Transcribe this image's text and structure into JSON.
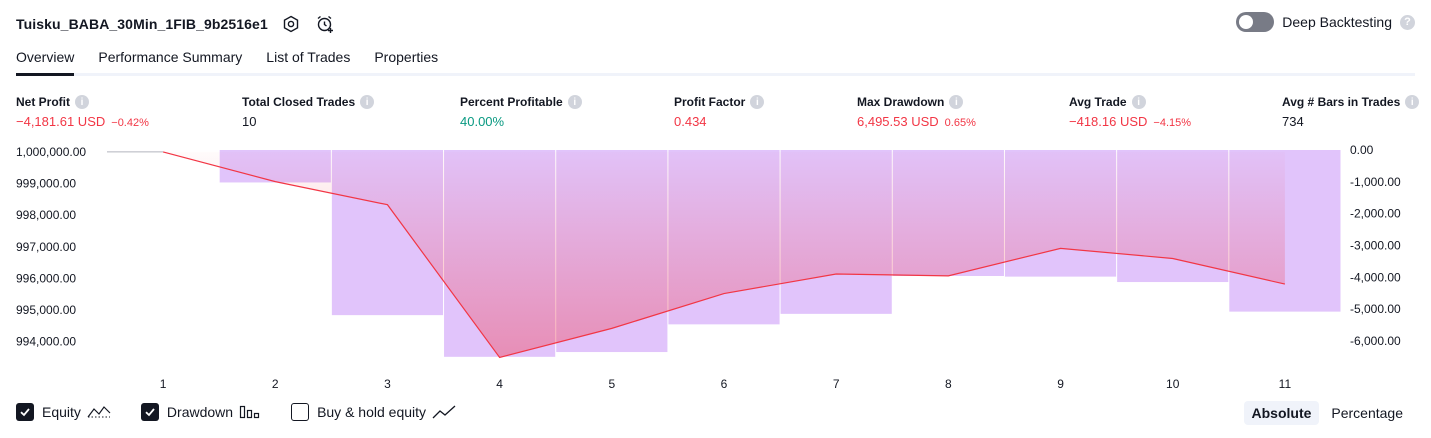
{
  "header": {
    "strategy_name": "Tuisku_BABA_30Min_1FIB_9b2516e1",
    "deep_backtesting_label": "Deep Backtesting",
    "help_glyph": "?"
  },
  "tabs": [
    {
      "label": "Overview",
      "active": true
    },
    {
      "label": "Performance Summary",
      "active": false
    },
    {
      "label": "List of Trades",
      "active": false
    },
    {
      "label": "Properties",
      "active": false
    }
  ],
  "metrics": [
    {
      "label": "Net Profit",
      "value": "−4,181.61 USD",
      "sub": "−0.42%",
      "tone": "neg"
    },
    {
      "label": "Total Closed Trades",
      "value": "10",
      "sub": "",
      "tone": "neutral"
    },
    {
      "label": "Percent Profitable",
      "value": "40.00%",
      "sub": "",
      "tone": "pos"
    },
    {
      "label": "Profit Factor",
      "value": "0.434",
      "sub": "",
      "tone": "neg"
    },
    {
      "label": "Max Drawdown",
      "value": "6,495.53 USD",
      "sub": "0.65%",
      "tone": "neg"
    },
    {
      "label": "Avg Trade",
      "value": "−418.16 USD",
      "sub": "−4.15%",
      "tone": "neg"
    },
    {
      "label": "Avg # Bars in Trades",
      "value": "734",
      "sub": "",
      "tone": "neutral"
    }
  ],
  "info_glyph": "i",
  "chart_data": {
    "type": "line",
    "x": [
      1,
      2,
      3,
      4,
      5,
      6,
      7,
      8,
      9,
      10,
      11
    ],
    "series": [
      {
        "name": "Equity",
        "kind": "line-area",
        "color": "#f23645",
        "values": [
          1000000,
          999060,
          998330,
          993500,
          994420,
          995520,
          996140,
          996080,
          996950,
          996630,
          995820
        ]
      },
      {
        "name": "Drawdown",
        "kind": "bar",
        "color": "#e1c4fb",
        "values": [
          0,
          -1020,
          -5190,
          -6500,
          -6350,
          -5480,
          -5150,
          -3960,
          -3980,
          -4150,
          -5080
        ]
      }
    ],
    "left_axis": {
      "ticks": [
        "1,000,000.00",
        "999,000.00",
        "998,000.00",
        "997,000.00",
        "996,000.00",
        "995,000.00",
        "994,000.00"
      ],
      "tick_values": [
        1000000,
        999000,
        998000,
        997000,
        996000,
        995000,
        994000
      ],
      "ylim": [
        993420,
        1000060
      ]
    },
    "right_axis": {
      "ticks": [
        "0.00",
        "-1,000.00",
        "-2,000.00",
        "-3,000.00",
        "-4,000.00",
        "-5,000.00",
        "-6,000.00"
      ],
      "tick_values": [
        0,
        -1000,
        -2000,
        -3000,
        -4000,
        -5000,
        -6000
      ],
      "ylim": [
        -6600,
        0
      ]
    },
    "x_ticks": [
      "1",
      "2",
      "3",
      "4",
      "5",
      "6",
      "7",
      "8",
      "9",
      "10",
      "11"
    ]
  },
  "legend": [
    {
      "label": "Equity",
      "checked": true,
      "icon": "area-line-icon"
    },
    {
      "label": "Drawdown",
      "checked": true,
      "icon": "bars-icon"
    },
    {
      "label": "Buy & hold equity",
      "checked": false,
      "icon": "line-icon"
    }
  ],
  "modes": [
    {
      "label": "Absolute",
      "active": true
    },
    {
      "label": "Percentage",
      "active": false
    }
  ]
}
